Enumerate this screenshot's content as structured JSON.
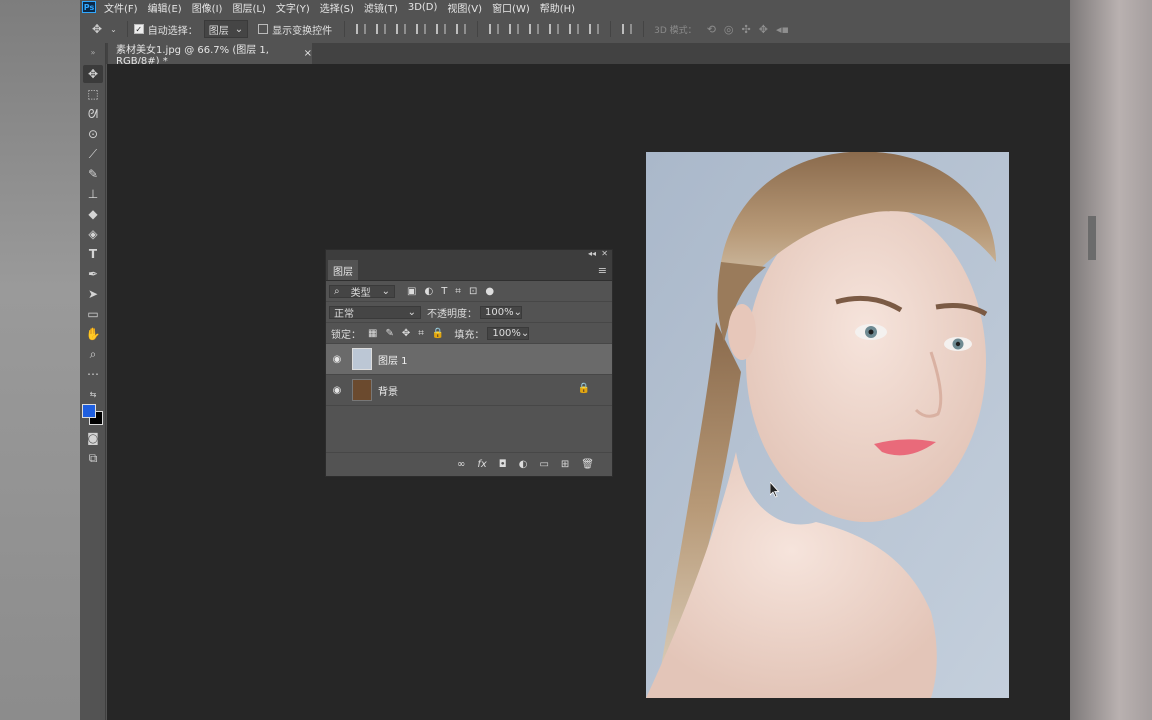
{
  "menubar": {
    "logo": "Ps",
    "items": [
      "文件(F)",
      "编辑(E)",
      "图像(I)",
      "图层(L)",
      "文字(Y)",
      "选择(S)",
      "滤镜(T)",
      "3D(D)",
      "视图(V)",
      "窗口(W)",
      "帮助(H)"
    ]
  },
  "options": {
    "auto_select_label": "自动选择：",
    "auto_select_value": "图层",
    "show_transform_label": "显示变换控件",
    "mode_3d_label": "3D 模式："
  },
  "document": {
    "tab_title": "素材美女1.jpg @ 66.7% (图层 1, RGB/8#) *",
    "close_glyph": "×"
  },
  "layers_panel": {
    "tab_label": "图层",
    "filter_label": "类型",
    "blend_mode": "正常",
    "opacity_label": "不透明度：",
    "opacity_value": "100%",
    "lock_label": "锁定：",
    "fill_label": "填充：",
    "fill_value": "100%",
    "layers": [
      {
        "name": "图层 1",
        "selected": true
      },
      {
        "name": "背景",
        "locked": true
      }
    ]
  },
  "colors": {
    "foreground": "#1f5fe0",
    "background": "#000000"
  }
}
